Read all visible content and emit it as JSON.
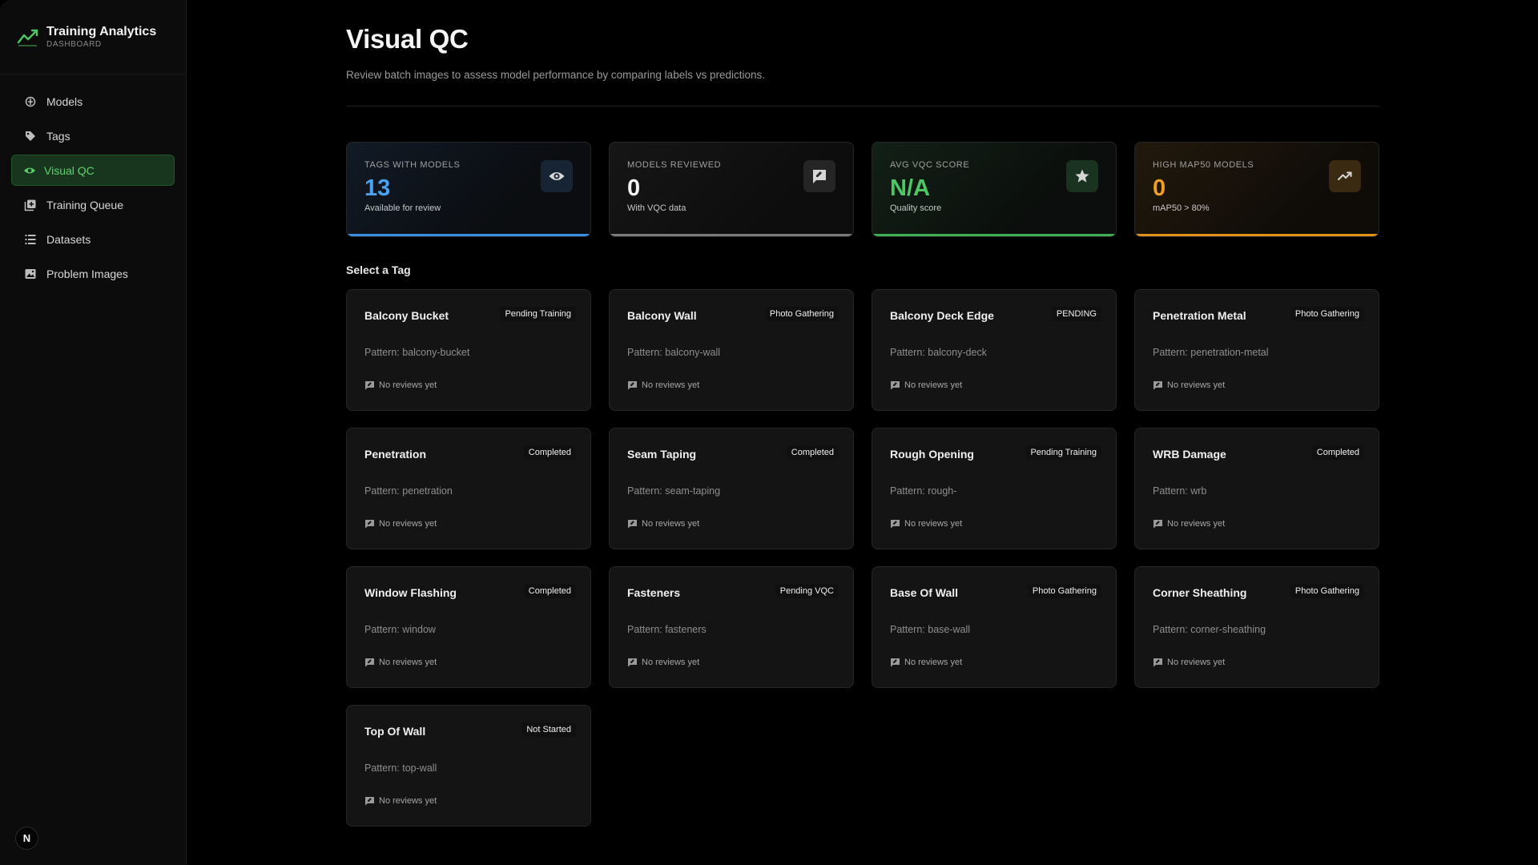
{
  "brand": {
    "title": "Training Analytics",
    "subtitle": "DASHBOARD",
    "accent": "#4cc764"
  },
  "sidebar": {
    "items": [
      {
        "label": "Models",
        "icon": "models-icon",
        "active": false
      },
      {
        "label": "Tags",
        "icon": "tag-icon",
        "active": false
      },
      {
        "label": "Visual QC",
        "icon": "eye-icon",
        "active": true
      },
      {
        "label": "Training Queue",
        "icon": "queue-icon",
        "active": false
      },
      {
        "label": "Datasets",
        "icon": "list-icon",
        "active": false
      },
      {
        "label": "Problem Images",
        "icon": "image-icon",
        "active": false
      }
    ],
    "footer_badge": "N"
  },
  "header": {
    "title": "Visual QC",
    "description": "Review batch images to assess model performance by comparing labels vs predictions."
  },
  "stats": [
    {
      "label": "TAGS WITH MODELS",
      "value": "13",
      "sub": "Available for review",
      "icon": "eye-icon",
      "color": "#4aa3f0"
    },
    {
      "label": "MODELS REVIEWED",
      "value": "0",
      "sub": "With VQC data",
      "icon": "review-icon",
      "color": "#f2f2f2"
    },
    {
      "label": "AVG VQC SCORE",
      "value": "N/A",
      "sub": "Quality score",
      "icon": "star-icon",
      "color": "#4cc764"
    },
    {
      "label": "HIGH MAP50 MODELS",
      "value": "0",
      "sub": "mAP50 > 80%",
      "icon": "trending-up-icon",
      "color": "#f0a020"
    }
  ],
  "section_title": "Select a Tag",
  "tags": [
    {
      "name": "Balcony Bucket",
      "status": "Pending Training",
      "pattern": "Pattern: balcony-bucket",
      "reviews": "No reviews yet"
    },
    {
      "name": "Balcony Wall",
      "status": "Photo Gathering",
      "pattern": "Pattern: balcony-wall",
      "reviews": "No reviews yet"
    },
    {
      "name": "Balcony Deck Edge",
      "status": "PENDING",
      "pattern": "Pattern: balcony-deck",
      "reviews": "No reviews yet"
    },
    {
      "name": "Penetration Metal",
      "status": "Photo Gathering",
      "pattern": "Pattern: penetration-metal",
      "reviews": "No reviews yet"
    },
    {
      "name": "Penetration",
      "status": "Completed",
      "pattern": "Pattern: penetration",
      "reviews": "No reviews yet"
    },
    {
      "name": "Seam Taping",
      "status": "Completed",
      "pattern": "Pattern: seam-taping",
      "reviews": "No reviews yet"
    },
    {
      "name": "Rough Opening",
      "status": "Pending Training",
      "pattern": "Pattern: rough-",
      "reviews": "No reviews yet"
    },
    {
      "name": "WRB Damage",
      "status": "Completed",
      "pattern": "Pattern: wrb",
      "reviews": "No reviews yet"
    },
    {
      "name": "Window Flashing",
      "status": "Completed",
      "pattern": "Pattern: window",
      "reviews": "No reviews yet"
    },
    {
      "name": "Fasteners",
      "status": "Pending VQC",
      "pattern": "Pattern: fasteners",
      "reviews": "No reviews yet"
    },
    {
      "name": "Base Of Wall",
      "status": "Photo Gathering",
      "pattern": "Pattern: base-wall",
      "reviews": "No reviews yet"
    },
    {
      "name": "Corner Sheathing",
      "status": "Photo Gathering",
      "pattern": "Pattern: corner-sheathing",
      "reviews": "No reviews yet"
    },
    {
      "name": "Top Of Wall",
      "status": "Not Started",
      "pattern": "Pattern: top-wall",
      "reviews": "No reviews yet"
    }
  ]
}
